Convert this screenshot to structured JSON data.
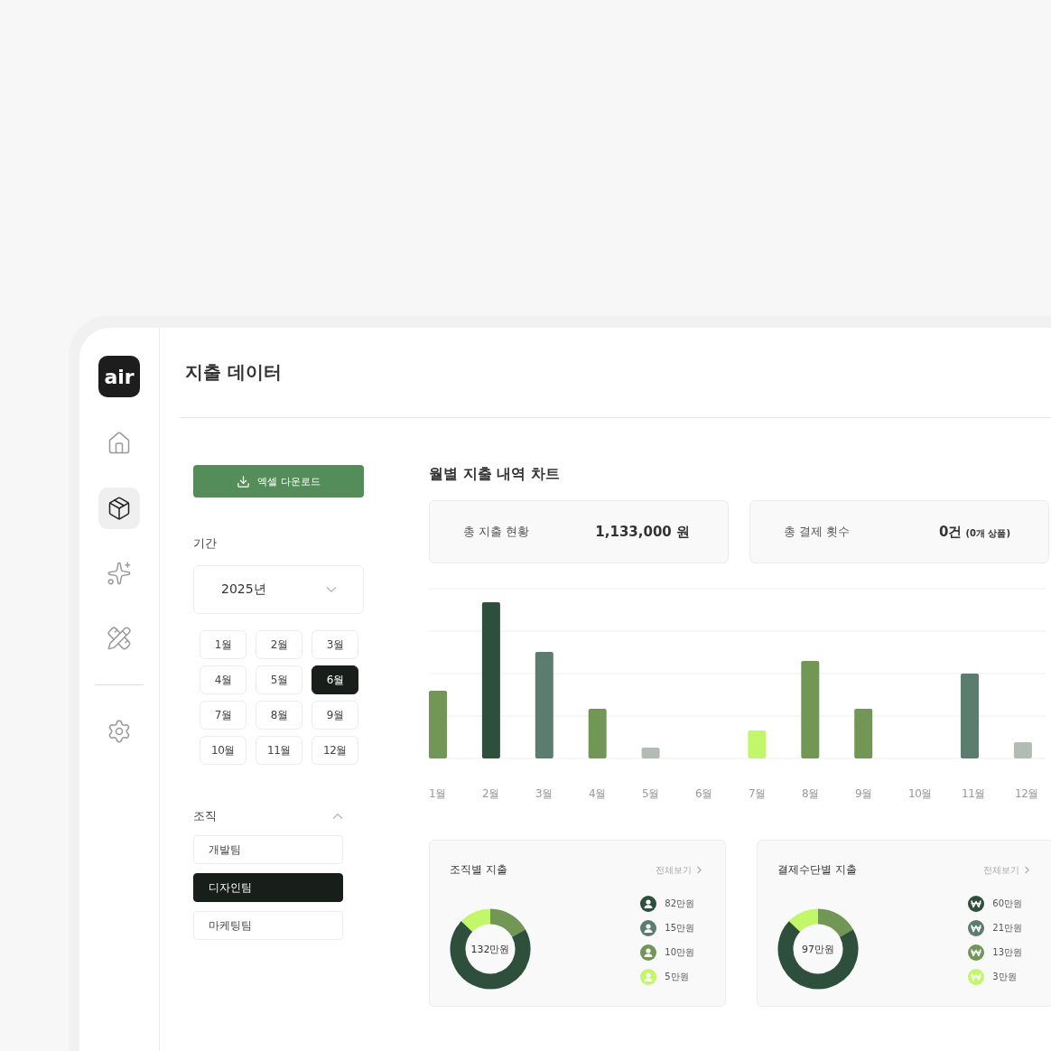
{
  "sidebar": {
    "logo": "air",
    "items": [
      {
        "selected": false
      },
      {
        "selected": true
      },
      {
        "selected": false
      },
      {
        "selected": false
      },
      {
        "selected": false
      }
    ]
  },
  "page_title": "지출 데이터",
  "download_button": "엑셀 다운로드",
  "period": {
    "label": "기간",
    "year": "2025년",
    "months": [
      {
        "label": "1월",
        "selected": false
      },
      {
        "label": "2월",
        "selected": false
      },
      {
        "label": "3월",
        "selected": false
      },
      {
        "label": "4월",
        "selected": false
      },
      {
        "label": "5월",
        "selected": false
      },
      {
        "label": "6월",
        "selected": true
      },
      {
        "label": "7월",
        "selected": false
      },
      {
        "label": "8월",
        "selected": false
      },
      {
        "label": "9월",
        "selected": false
      },
      {
        "label": "10월",
        "selected": false
      },
      {
        "label": "11월",
        "selected": false
      },
      {
        "label": "12월",
        "selected": false
      }
    ]
  },
  "organization": {
    "label": "조직",
    "expanded": true,
    "teams": [
      {
        "label": "개발팀",
        "selected": false
      },
      {
        "label": "디자인팀",
        "selected": true
      },
      {
        "label": "마케팅팀",
        "selected": false
      }
    ]
  },
  "chart_title": "월별 지출 내역 차트",
  "stats": [
    {
      "label": "총 지출 현황",
      "value": "1,133,000 원"
    },
    {
      "label": "총 결제 횟수",
      "value": "0건",
      "note": "(0개 상품)"
    }
  ],
  "chart_x_labels": [
    "1월",
    "2월",
    "3월",
    "4월",
    "5월",
    "6월",
    "7월",
    "8월",
    "9월",
    "10월",
    "11월",
    "12월"
  ],
  "breakdowns": [
    {
      "title": "조직별 지출",
      "link": "전체보기",
      "total": "132만원",
      "kind": "person",
      "legend": [
        {
          "amount": "82만원",
          "color": "#2d4f3c"
        },
        {
          "amount": "15만원",
          "color": "#5a7d6f"
        },
        {
          "amount": "10만원",
          "color": "#729656"
        },
        {
          "amount": "5만원",
          "color": "#c2f76a"
        }
      ]
    },
    {
      "title": "결제수단별 지출",
      "link": "전체보기",
      "total": "97만원",
      "kind": "won",
      "legend": [
        {
          "amount": "60만원",
          "color": "#2d4f3c"
        },
        {
          "amount": "21만원",
          "color": "#5a7d6f"
        },
        {
          "amount": "13만원",
          "color": "#729656"
        },
        {
          "amount": "3만원",
          "color": "#c2f76a"
        }
      ]
    }
  ]
}
